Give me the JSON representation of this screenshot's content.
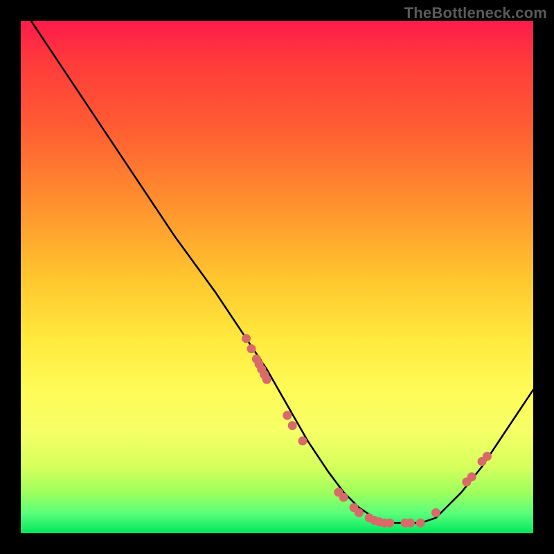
{
  "watermark": "TheBottleneck.com",
  "chart_data": {
    "type": "line",
    "title": "",
    "xlabel": "",
    "ylabel": "",
    "xlim": [
      0,
      100
    ],
    "ylim": [
      0,
      100
    ],
    "grid": false,
    "series": [
      {
        "name": "bottleneck-curve",
        "x": [
          2,
          10,
          20,
          30,
          38,
          44,
          48,
          52,
          56,
          60,
          63,
          66,
          69,
          72,
          75,
          78,
          81,
          83,
          86,
          90,
          94,
          98,
          100
        ],
        "y": [
          100,
          88,
          73,
          58,
          47,
          38,
          32,
          25,
          18,
          12,
          8,
          5,
          3,
          2,
          2,
          2,
          3,
          5,
          8,
          13,
          19,
          25,
          28
        ]
      }
    ],
    "scatter_points": {
      "name": "highlighted-dots",
      "color": "#d86a6a",
      "points": [
        {
          "x": 44,
          "y": 38
        },
        {
          "x": 45,
          "y": 36
        },
        {
          "x": 46,
          "y": 34
        },
        {
          "x": 46.5,
          "y": 33
        },
        {
          "x": 47,
          "y": 32
        },
        {
          "x": 47.5,
          "y": 31
        },
        {
          "x": 48,
          "y": 30
        },
        {
          "x": 52,
          "y": 23
        },
        {
          "x": 53,
          "y": 21
        },
        {
          "x": 55,
          "y": 18
        },
        {
          "x": 62,
          "y": 8
        },
        {
          "x": 63,
          "y": 7
        },
        {
          "x": 65,
          "y": 5
        },
        {
          "x": 66,
          "y": 4
        },
        {
          "x": 68,
          "y": 3
        },
        {
          "x": 69,
          "y": 2.5
        },
        {
          "x": 70,
          "y": 2.2
        },
        {
          "x": 71,
          "y": 2
        },
        {
          "x": 72,
          "y": 2
        },
        {
          "x": 75,
          "y": 2
        },
        {
          "x": 76,
          "y": 2
        },
        {
          "x": 78,
          "y": 2
        },
        {
          "x": 81,
          "y": 4
        },
        {
          "x": 87,
          "y": 10
        },
        {
          "x": 88,
          "y": 11
        },
        {
          "x": 90,
          "y": 14
        },
        {
          "x": 91,
          "y": 15
        }
      ]
    }
  }
}
